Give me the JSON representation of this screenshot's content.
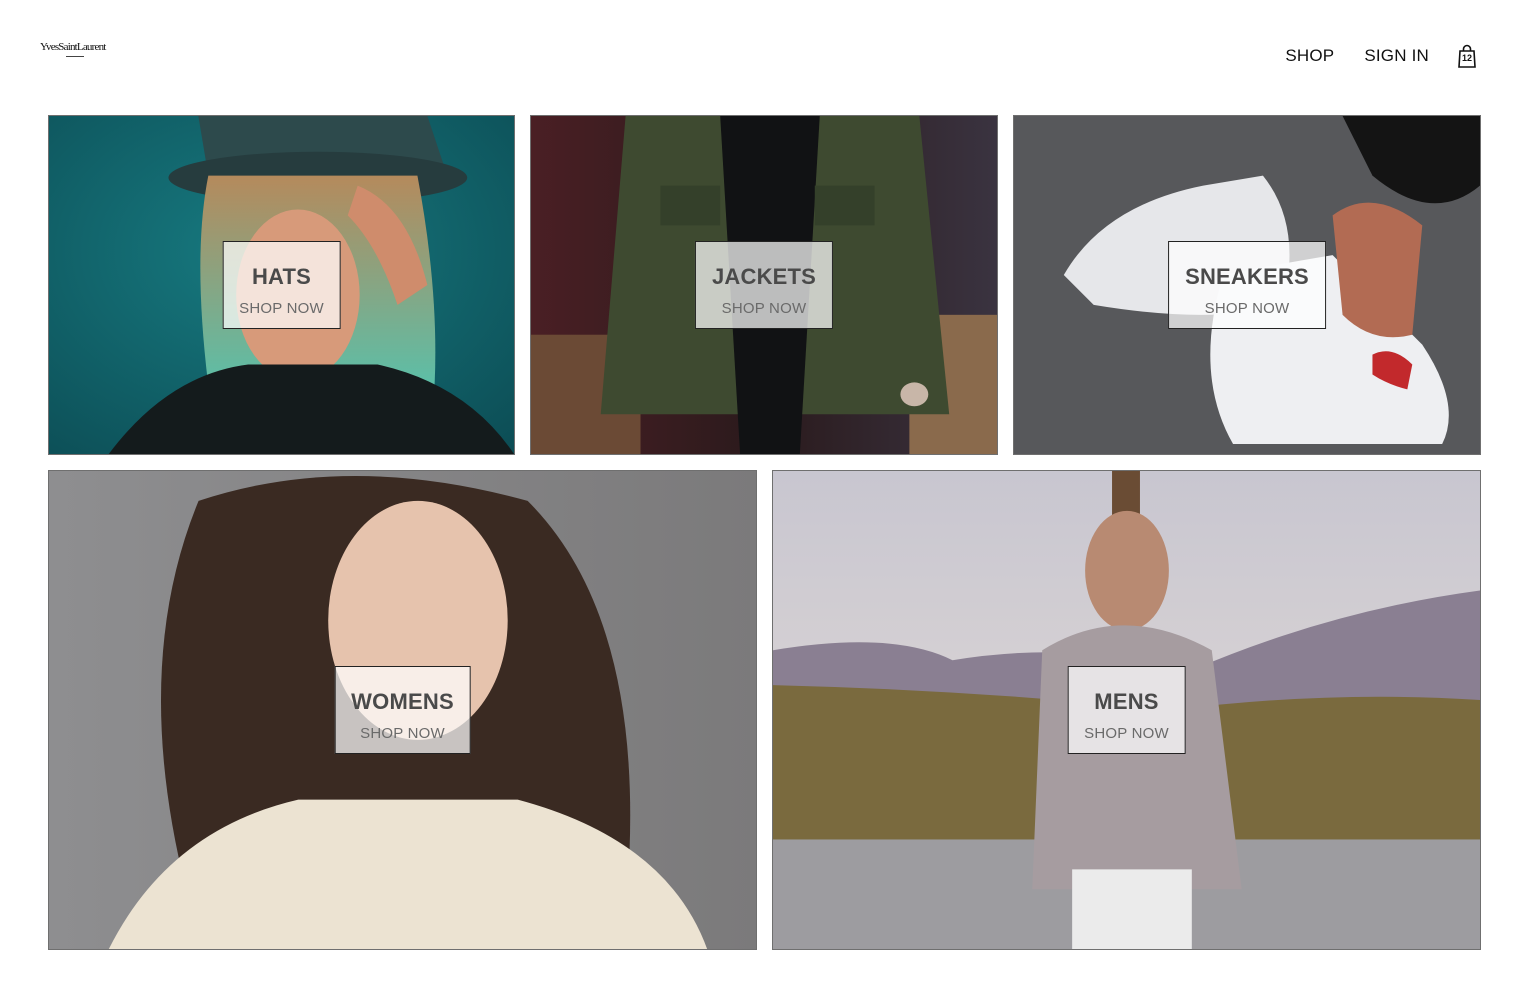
{
  "brand": {
    "logo_text": "YvesSaintLaurent"
  },
  "nav": {
    "shop_label": "SHOP",
    "sign_in_label": "SIGN IN",
    "cart_count": "12",
    "cart_icon": "shopping-bag-icon"
  },
  "categories": [
    {
      "title": "HATS",
      "cta": "SHOP NOW",
      "image": "woman-in-teal-hat-photo"
    },
    {
      "title": "JACKETS",
      "cta": "SHOP NOW",
      "image": "man-in-green-jacket-photo"
    },
    {
      "title": "SNEAKERS",
      "cta": "SHOP NOW",
      "image": "white-sneakers-on-asphalt-photo"
    },
    {
      "title": "WOMENS",
      "cta": "SHOP NOW",
      "image": "woman-portrait-photo"
    },
    {
      "title": "MENS",
      "cta": "SHOP NOW",
      "image": "man-outdoors-photo"
    }
  ],
  "colors": {
    "overlay_bg": "#ffffffb8",
    "title_color": "#4a4a4a",
    "cta_color": "#6a6a6a"
  }
}
